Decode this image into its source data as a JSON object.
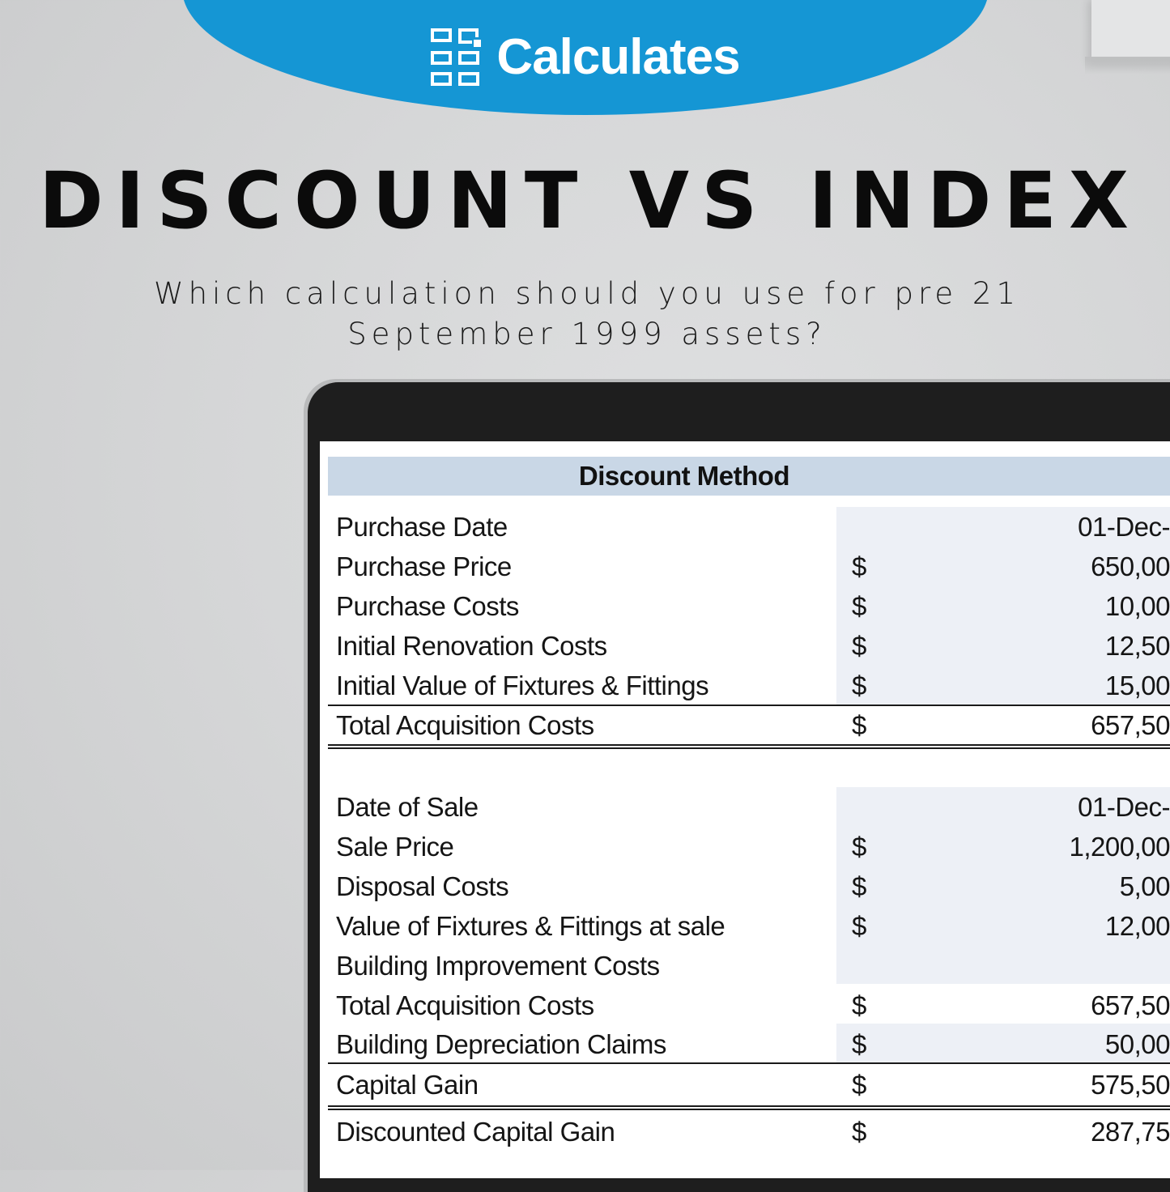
{
  "brand": {
    "name": "Calculates",
    "icon": "calculator-grid-icon",
    "accent_color": "#1596d4"
  },
  "headline": "DISCOUNT VS INDEX",
  "subtitle_line1": "Which calculation should you use for pre 21",
  "subtitle_line2": "September 1999 assets?",
  "sheet": {
    "title": "Discount Method",
    "header_color": "#c9d7e6",
    "input_cell_color": "#edf0f6",
    "acquisition_rows": [
      {
        "label": "Purchase Date",
        "currency": "",
        "value": "01-Dec-"
      },
      {
        "label": "Purchase Price",
        "currency": "$",
        "value": "650,00"
      },
      {
        "label": "Purchase Costs",
        "currency": "$",
        "value": "10,00"
      },
      {
        "label": "Initial Renovation Costs",
        "currency": "$",
        "value": "12,50"
      },
      {
        "label": "Initial Value of Fixtures & Fittings",
        "currency": "$",
        "value": "15,00"
      }
    ],
    "acquisition_total": {
      "label": "Total Acquisition Costs",
      "currency": "$",
      "value": "657,50"
    },
    "sale_rows": [
      {
        "label": "Date of Sale",
        "currency": "",
        "value": "01-Dec-"
      },
      {
        "label": "Sale Price",
        "currency": "$",
        "value": "1,200,00"
      },
      {
        "label": "Disposal Costs",
        "currency": "$",
        "value": "5,00"
      },
      {
        "label": "Value of Fixtures & Fittings at sale",
        "currency": "$",
        "value": "12,00"
      },
      {
        "label": "Building Improvement Costs",
        "currency": "",
        "value": ""
      },
      {
        "label": "Total Acquisition Costs",
        "currency": "$",
        "value": "657,50"
      },
      {
        "label": "Building Depreciation Claims",
        "currency": "$",
        "value": "50,00"
      }
    ],
    "capital_gain": {
      "label": "Capital Gain",
      "currency": "$",
      "value": "575,50"
    },
    "discounted_capital_gain": {
      "label": "Discounted Capital Gain",
      "currency": "$",
      "value": "287,75"
    }
  }
}
